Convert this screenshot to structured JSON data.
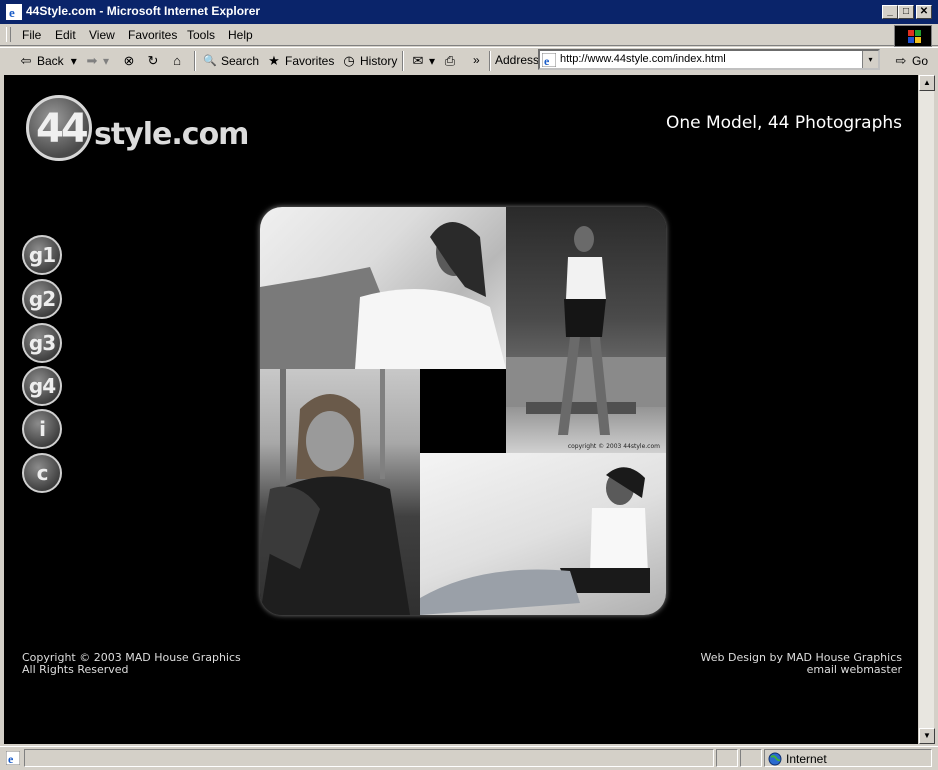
{
  "window": {
    "title": "44Style.com - Microsoft Internet Explorer",
    "min_label": "_",
    "max_label": "□",
    "close_label": "✕"
  },
  "menu": {
    "items": [
      "File",
      "Edit",
      "View",
      "Favorites",
      "Tools",
      "Help"
    ]
  },
  "toolbar": {
    "back": "Back",
    "back_arrow": "⇦",
    "forward_arrow": "➡",
    "stop_glyph": "⊗",
    "refresh_glyph": "↻",
    "home_glyph": "⌂",
    "search": "Search",
    "search_glyph": "🔍",
    "favorites": "Favorites",
    "favorites_glyph": "★",
    "history": "History",
    "history_glyph": "◷",
    "mail_glyph": "✉",
    "print_glyph": "⎙",
    "more_glyph": "»",
    "dropdown_glyph": "▾",
    "address_label": "Address",
    "address_url": "http://www.44style.com/index.html",
    "go": "Go"
  },
  "page": {
    "logo_number": "44",
    "logo_text": "style.com",
    "tagline": "One Model, 44 Photographs",
    "nav": [
      "g1",
      "g2",
      "g3",
      "g4",
      "i",
      "c"
    ],
    "photo_copyright": "copyright © 2003 44style.com",
    "footer_left_line1": "Copyright © 2003 MAD House Graphics",
    "footer_left_line2": "All Rights Reserved",
    "footer_right_line1": "Web Design by MAD House Graphics",
    "footer_right_line2": "email webmaster"
  },
  "scrollbar": {
    "up": "▲",
    "down": "▼"
  },
  "status": {
    "zone": "Internet"
  },
  "colors": {
    "titlebar": "#0a246a",
    "chrome": "#d4d0c8",
    "page_bg": "#000000"
  }
}
